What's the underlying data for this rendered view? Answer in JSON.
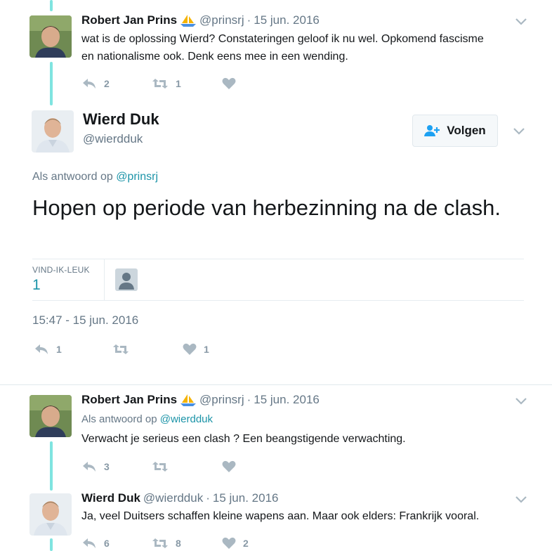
{
  "tweet1": {
    "name": "Robert Jan Prins",
    "emoji": "boat-emoji",
    "handle": "@prinsrj",
    "dot": "·",
    "date": "15 jun. 2016",
    "text_line1": "wat is de oplossing Wierd? Constateringen geloof ik nu wel. Opkomend fascisme",
    "text_line2": "en nationalisme ook. Denk eens mee in een wending.",
    "reply_count": "2",
    "retweet_count": "1",
    "like_count": ""
  },
  "main_tweet": {
    "name": "Wierd Duk",
    "handle": "@wierdduk",
    "follow_label": "Volgen",
    "reply_prefix": "Als antwoord op",
    "reply_mention": "@prinsrj",
    "text": "Hopen op periode van herbezinning na de clash.",
    "likes_label": "VIND-IK-LEUK",
    "likes_value": "1",
    "timestamp": "15:47 - 15 jun. 2016",
    "reply_count": "1",
    "retweet_count": "",
    "like_count": "1"
  },
  "tweet3": {
    "name": "Robert Jan Prins",
    "emoji": "boat-emoji",
    "handle": "@prinsrj",
    "dot": "·",
    "date": "15 jun. 2016",
    "reply_prefix": "Als antwoord op",
    "reply_mention": "@wierdduk",
    "text": "Verwacht je serieus een clash ? Een beangstigende verwachting.",
    "reply_count": "3",
    "retweet_count": "",
    "like_count": ""
  },
  "tweet4": {
    "name": "Wierd Duk",
    "handle": "@wierdduk",
    "dot": "·",
    "date": "15 jun. 2016",
    "text": "Ja, veel Duitsers schaffen kleine wapens aan. Maar ook elders: Frankrijk vooral.",
    "reply_count": "6",
    "retweet_count": "8",
    "like_count": "2"
  },
  "colors": {
    "thread": "#7fe4e0",
    "link": "#1c94a8",
    "muted": "#657786",
    "icon": "#aab8c2"
  }
}
